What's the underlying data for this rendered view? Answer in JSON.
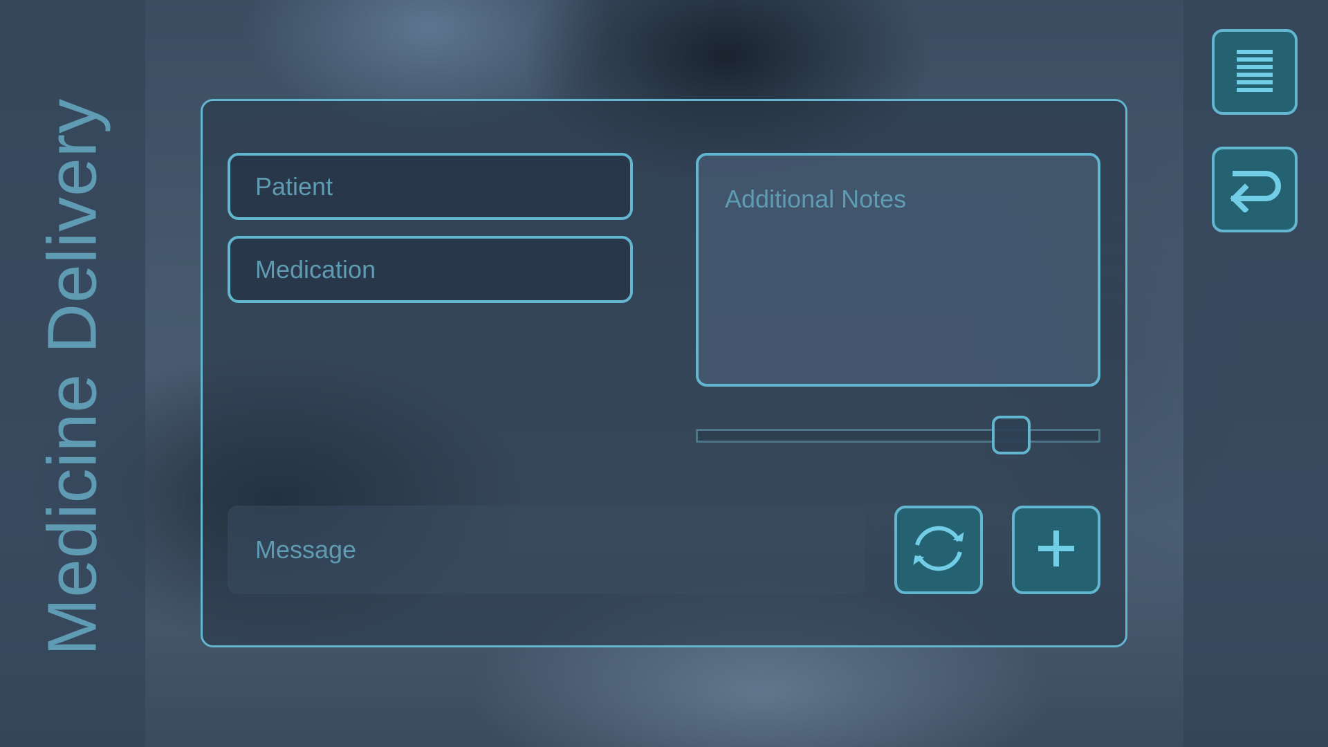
{
  "app": {
    "title": "Medicine Delivery"
  },
  "form": {
    "patient_placeholder": "Patient",
    "medication_placeholder": "Medication",
    "notes_placeholder": "Additional Notes",
    "message_placeholder": "Message"
  },
  "slider": {
    "value_fraction": 0.78
  },
  "icons": {
    "menu": "menu-lines-icon",
    "back": "return-arrow-icon",
    "refresh": "refresh-icon",
    "add": "plus-icon"
  },
  "colors": {
    "accent": "#62b6d0",
    "button_fill": "#246272",
    "text": "#5f9bb2",
    "panel_bg": "#2f4256"
  }
}
